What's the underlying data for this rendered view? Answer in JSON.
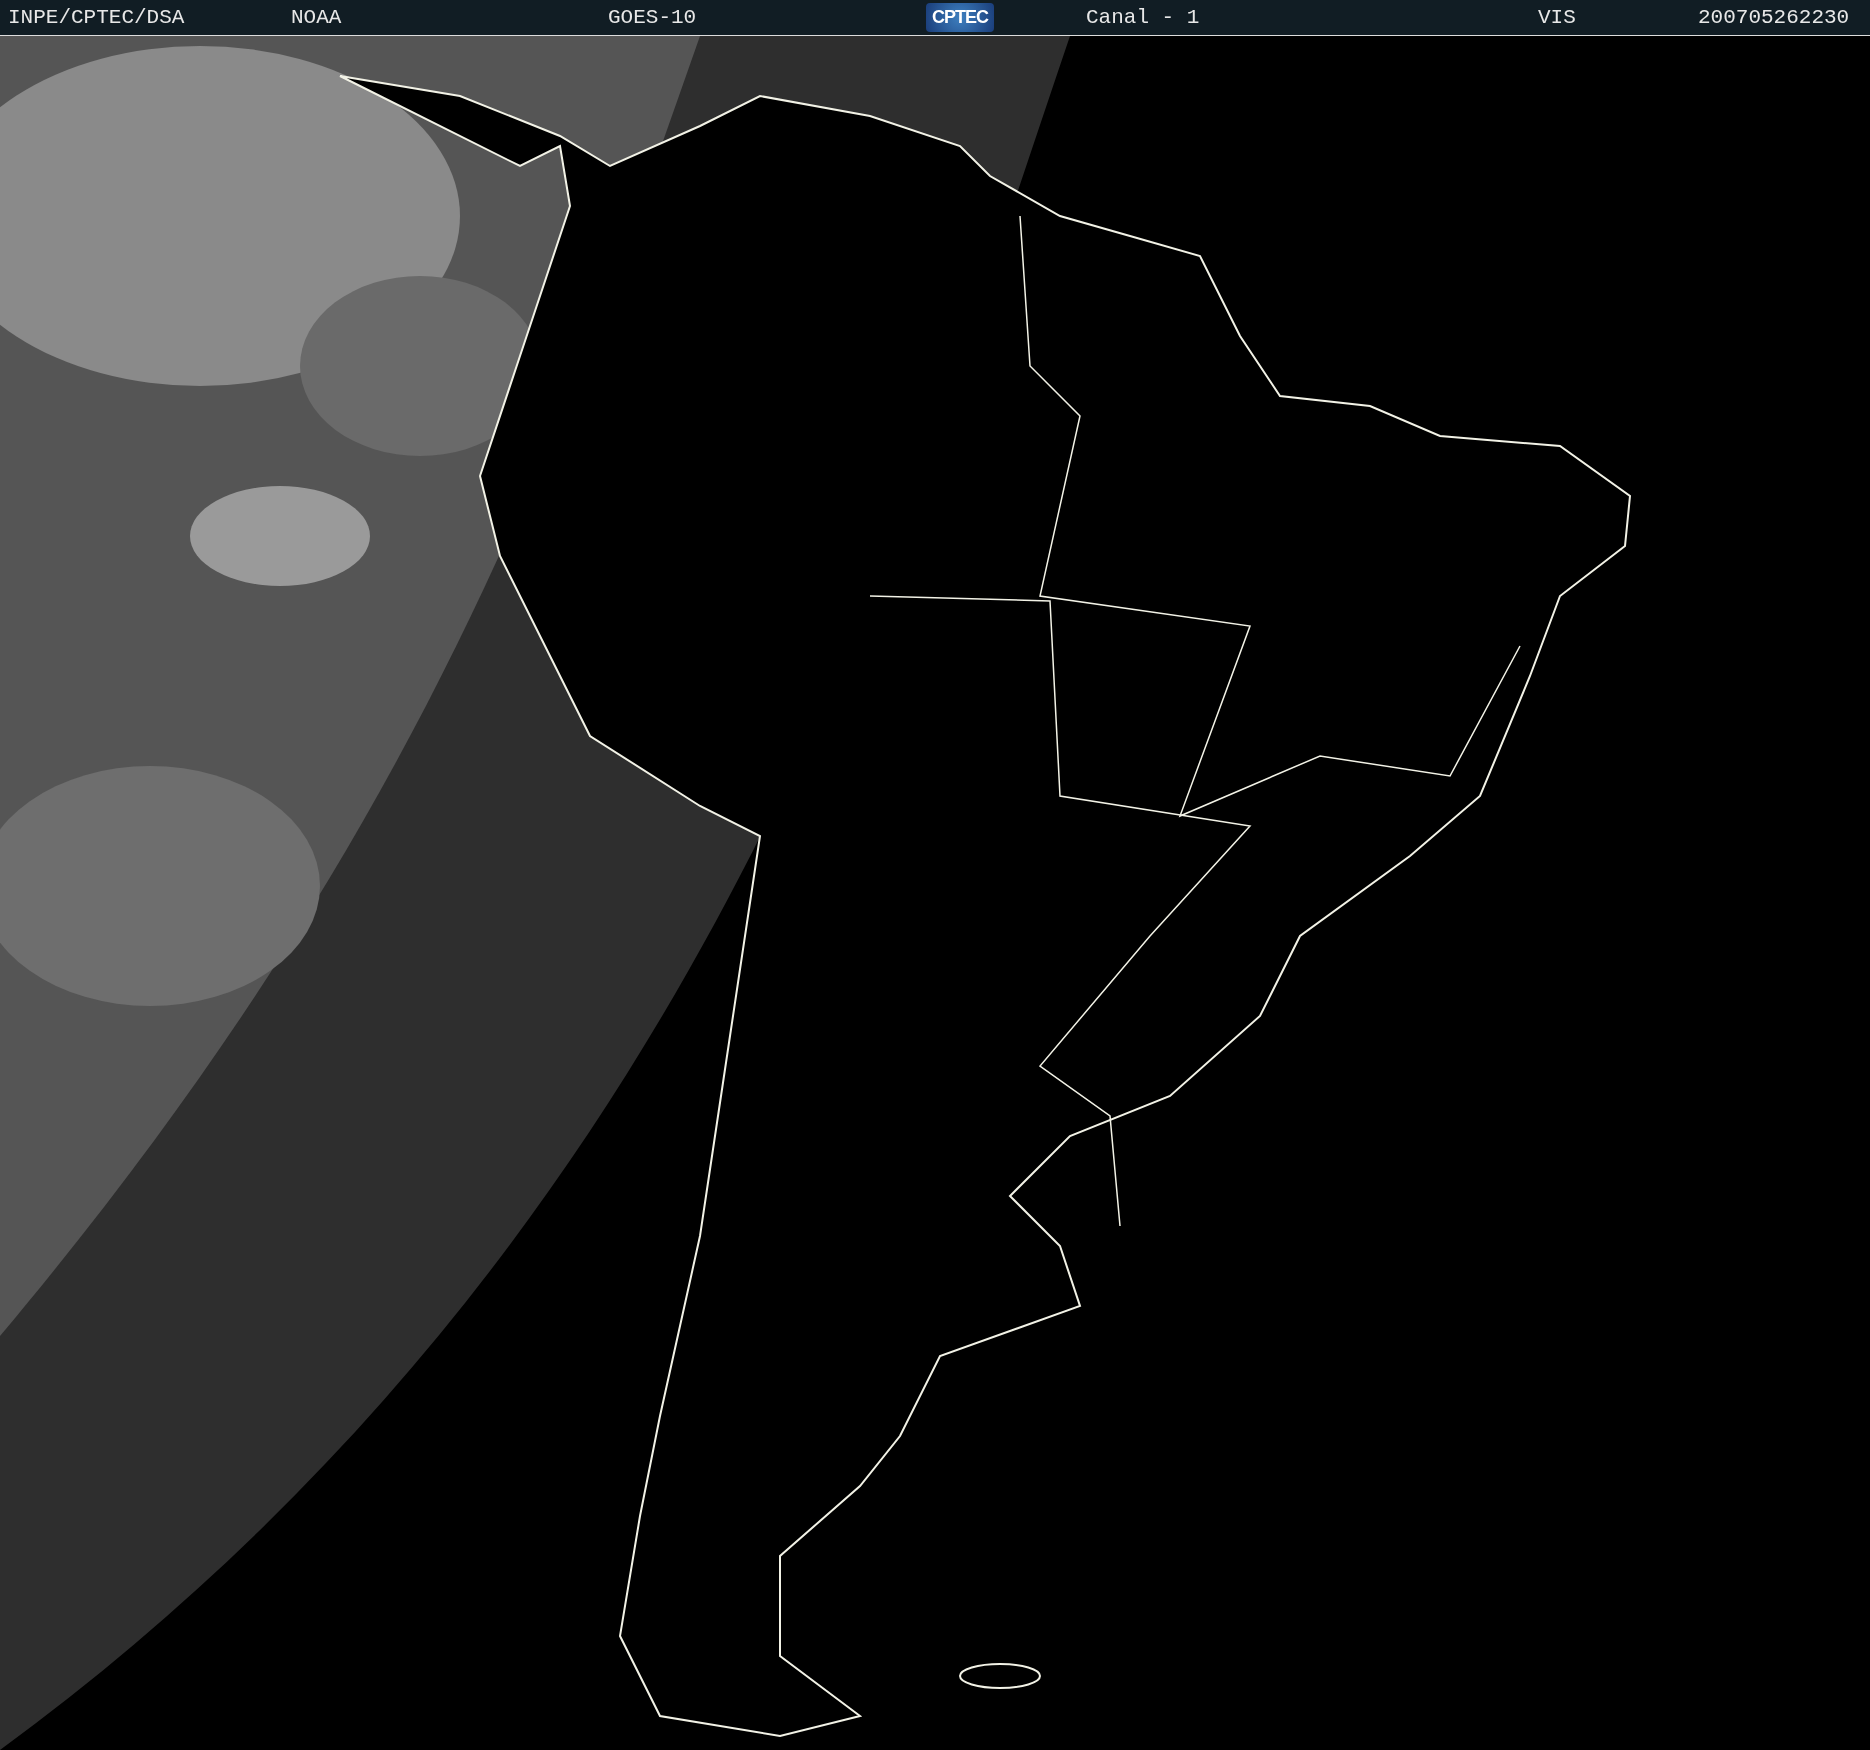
{
  "header": {
    "items": [
      {
        "kind": "text",
        "text": "INPE/CPTEC/DSA"
      },
      {
        "kind": "text",
        "text": "NOAA"
      },
      {
        "kind": "text",
        "text": "GOES-10"
      },
      {
        "kind": "logo",
        "text": "CPTEC"
      },
      {
        "kind": "text",
        "text": "Canal - 1"
      },
      {
        "kind": "text",
        "text": "VIS"
      },
      {
        "kind": "text",
        "text": "200705262230"
      }
    ]
  }
}
